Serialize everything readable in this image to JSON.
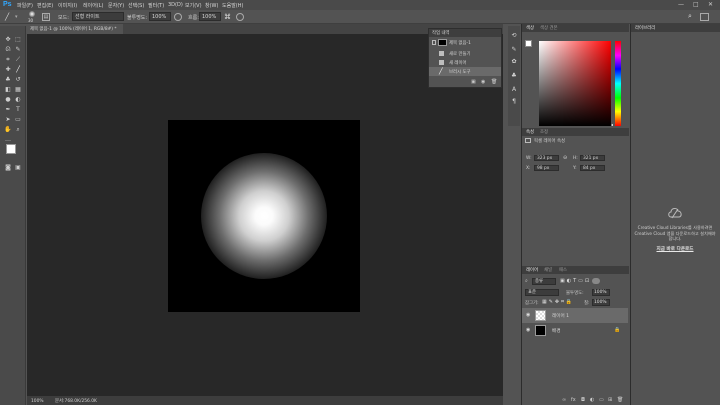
{
  "menubar": {
    "logo": "Ps",
    "items": [
      "파일(F)",
      "편집(E)",
      "이미지(I)",
      "레이어(L)",
      "문자(Y)",
      "선택(S)",
      "필터(T)",
      "3D(D)",
      "보기(V)",
      "창(W)",
      "도움말(H)"
    ],
    "window_controls": [
      "—",
      "□",
      "✕"
    ]
  },
  "options_bar": {
    "brush_size": "30",
    "mode_label": "모드:",
    "mode_value": "선형 라이트",
    "opacity_label": "불투명도:",
    "opacity_value": "100%",
    "flow_label": "흐름:",
    "flow_value": "100%"
  },
  "document": {
    "tab_title": "제목 없음-1 @ 100% (레이어 1, RGB/8#) *",
    "zoom": "100%",
    "status": "문서:768.0K/256.0K"
  },
  "history_panel": {
    "title": "작업 내역",
    "snapshot": "제목 없음-1",
    "items": [
      "새로 만들기",
      "새 레이어",
      "브러시 도구"
    ]
  },
  "color_panel": {
    "tabs": [
      "색상",
      "색상 견본"
    ],
    "foreground": "#ffffff",
    "background": "#000000",
    "hue_color": "#ff0000"
  },
  "properties_panel": {
    "tabs": [
      "속성",
      "조정"
    ],
    "heading": "픽셀 레이어 속성",
    "w_label": "W:",
    "w_value": "323 px",
    "h_label": "H:",
    "h_value": "321 px",
    "x_label": "X:",
    "x_value": "98 px",
    "y_label": "Y:",
    "y_value": "84 px"
  },
  "layers_panel": {
    "tabs": [
      "레이어",
      "채널",
      "패스"
    ],
    "kind_label": "종류",
    "blend_mode": "표준",
    "opacity_label": "불투명도:",
    "opacity_value": "100%",
    "lock_label": "잠그기:",
    "fill_label": "칠:",
    "fill_value": "100%",
    "layers": [
      {
        "name": "레이어 1",
        "selected": true
      },
      {
        "name": "배경",
        "selected": false
      }
    ],
    "footer_icons": [
      "link-icon",
      "fx-icon",
      "mask-icon",
      "adjustment-icon",
      "group-icon",
      "new-layer-icon",
      "trash-icon"
    ]
  },
  "libraries_panel": {
    "title": "라이브러리",
    "message": "Creative Cloud Libraries를 사용하려면 Creative Cloud 앱을 다운로드하고 설치해야 합니다.",
    "link": "지금 바로 다운로드"
  }
}
